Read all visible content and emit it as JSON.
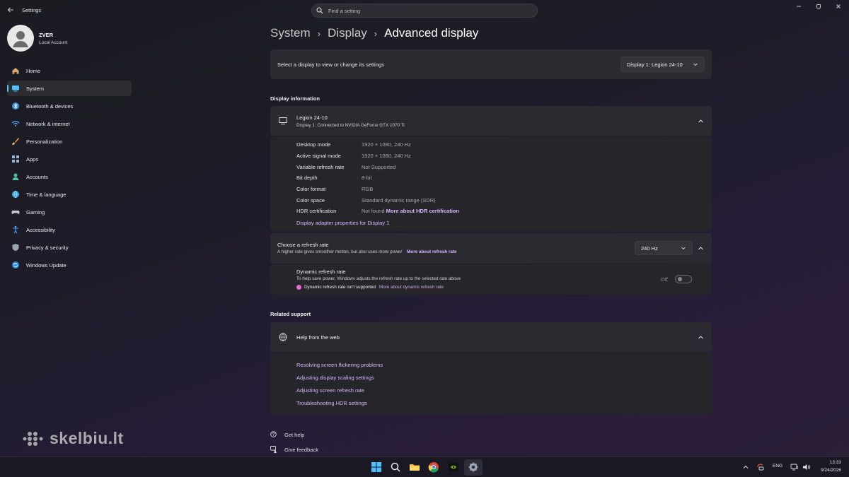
{
  "window": {
    "app_title": "Settings",
    "search_placeholder": "Find a setting"
  },
  "profile": {
    "name": "ZVER",
    "account_type": "Local Account"
  },
  "sidebar": {
    "items": [
      {
        "label": "Home",
        "icon": "home-icon"
      },
      {
        "label": "System",
        "icon": "system-icon",
        "active": true
      },
      {
        "label": "Bluetooth & devices",
        "icon": "bluetooth-icon"
      },
      {
        "label": "Network & internet",
        "icon": "wifi-icon"
      },
      {
        "label": "Personalization",
        "icon": "brush-icon"
      },
      {
        "label": "Apps",
        "icon": "apps-icon"
      },
      {
        "label": "Accounts",
        "icon": "accounts-icon"
      },
      {
        "label": "Time & language",
        "icon": "globe-clock-icon"
      },
      {
        "label": "Gaming",
        "icon": "gamepad-icon"
      },
      {
        "label": "Accessibility",
        "icon": "accessibility-icon"
      },
      {
        "label": "Privacy & security",
        "icon": "shield-icon"
      },
      {
        "label": "Windows Update",
        "icon": "update-icon"
      }
    ]
  },
  "breadcrumb": {
    "items": [
      "System",
      "Display",
      "Advanced display"
    ]
  },
  "display_select": {
    "label": "Select a display to view or change its settings",
    "selected": "Display 1: Legion 24-10"
  },
  "display_information": {
    "section_title": "Display information",
    "name": "Legion 24-10",
    "description": "Display 1: Connected to NVIDIA GeForce GTX 1070 Ti",
    "rows": [
      {
        "key": "Desktop mode",
        "value": "1920 × 1080, 240 Hz"
      },
      {
        "key": "Active signal mode",
        "value": "1920 × 1080, 240 Hz"
      },
      {
        "key": "Variable refresh rate",
        "value": "Not Supported"
      },
      {
        "key": "Bit depth",
        "value": "8-bit"
      },
      {
        "key": "Color format",
        "value": "RGB"
      },
      {
        "key": "Color space",
        "value": "Standard dynamic range (SDR)"
      },
      {
        "key": "HDR certification",
        "value": "Not found",
        "link": "More about HDR certification"
      }
    ],
    "adapter_link": "Display adapter properties for Display 1"
  },
  "refresh_rate": {
    "title": "Choose a refresh rate",
    "description": "A higher rate gives smoother motion, but also uses more power",
    "link": "More about refresh rate",
    "selected": "240 Hz"
  },
  "dynamic_refresh": {
    "title": "Dynamic refresh rate",
    "description": "To help save power, Windows adjusts the refresh rate up to the selected rate above",
    "warning": "Dynamic refresh rate isn't supported",
    "warning_link": "More about dynamic refresh rate",
    "toggle_state": "Off"
  },
  "related_support": {
    "section_title": "Related support",
    "title": "Help from the web",
    "links": [
      "Resolving screen flickering problems",
      "Adjusting display scaling settings",
      "Adjusting screen refresh rate",
      "Troubleshooting HDR settings"
    ]
  },
  "footer": {
    "get_help": "Get help",
    "give_feedback": "Give feedback"
  },
  "watermark": {
    "text": "skelbiu.lt"
  },
  "taskbar": {
    "language": "ENG",
    "time": "13:33",
    "date": "9/24/2026"
  },
  "colors": {
    "accent": "#4cc2ff",
    "link": "#d6b6ff",
    "warning_dot": "#e36ad8",
    "card": "#2b2a30"
  }
}
